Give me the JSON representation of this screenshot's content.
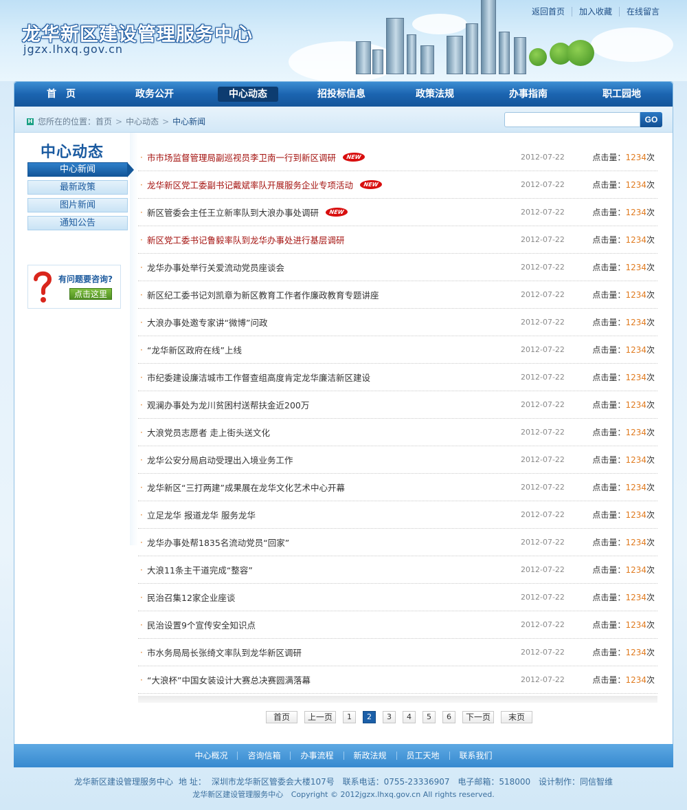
{
  "header": {
    "site_title": "龙华新区建设管理服务中心",
    "site_domain": "jgzx.lhxq.gov.cn",
    "top_links": [
      "返回首页",
      "加入收藏",
      "在线留言"
    ]
  },
  "nav": {
    "items": [
      "首　页",
      "政务公开",
      "中心动态",
      "招投标信息",
      "政策法规",
      "办事指南",
      "职工园地"
    ],
    "active_index": 2
  },
  "breadcrumb": {
    "prefix": "您所在的位置：",
    "items": [
      "首页",
      "中心动态",
      "中心新闻"
    ]
  },
  "search": {
    "placeholder": "",
    "button_label": "GO"
  },
  "sidebar": {
    "title": "中心动态",
    "items": [
      "中心新闻",
      "最新政策",
      "图片新闻",
      "通知公告"
    ],
    "active_index": 0,
    "consult_text": "有问题要咨询?",
    "consult_button": "点击这里"
  },
  "news": {
    "hits_label": "点击量：",
    "hits_unit": "次",
    "items": [
      {
        "title": "市市场监督管理局副巡视员李卫南一行到新区调研",
        "date": "2012-07-22",
        "hits": "1234",
        "hot": true,
        "new": true
      },
      {
        "title": "龙华新区党工委副书记戴斌率队开展服务企业专项活动",
        "date": "2012-07-22",
        "hits": "1234",
        "hot": true,
        "new": true
      },
      {
        "title": "新区管委会主任王立新率队到大浪办事处调研",
        "date": "2012-07-22",
        "hits": "1234",
        "hot": false,
        "new": true
      },
      {
        "title": "新区党工委书记鲁毅率队到龙华办事处进行基层调研",
        "date": "2012-07-22",
        "hits": "1234",
        "hot": true,
        "new": false
      },
      {
        "title": "龙华办事处举行关爱流动党员座谈会",
        "date": "2012-07-22",
        "hits": "1234",
        "hot": false,
        "new": false
      },
      {
        "title": "新区纪工委书记刘凯章为新区教育工作者作廉政教育专题讲座",
        "date": "2012-07-22",
        "hits": "1234",
        "hot": false,
        "new": false
      },
      {
        "title": "大浪办事处邀专家讲“微博”问政",
        "date": "2012-07-22",
        "hits": "1234",
        "hot": false,
        "new": false
      },
      {
        "title": "“龙华新区政府在线”上线",
        "date": "2012-07-22",
        "hits": "1234",
        "hot": false,
        "new": false
      },
      {
        "title": "市纪委建设廉洁城市工作督查组高度肯定龙华廉洁新区建设",
        "date": "2012-07-22",
        "hits": "1234",
        "hot": false,
        "new": false
      },
      {
        "title": "观澜办事处为龙川贫困村送帮扶金近200万",
        "date": "2012-07-22",
        "hits": "1234",
        "hot": false,
        "new": false
      },
      {
        "title": "大浪党员志愿者 走上街头送文化",
        "date": "2012-07-22",
        "hits": "1234",
        "hot": false,
        "new": false
      },
      {
        "title": "龙华公安分局启动受理出入境业务工作",
        "date": "2012-07-22",
        "hits": "1234",
        "hot": false,
        "new": false
      },
      {
        "title": "龙华新区“三打两建”成果展在龙华文化艺术中心开幕",
        "date": "2012-07-22",
        "hits": "1234",
        "hot": false,
        "new": false
      },
      {
        "title": "立足龙华 报道龙华 服务龙华",
        "date": "2012-07-22",
        "hits": "1234",
        "hot": false,
        "new": false
      },
      {
        "title": "龙华办事处帮1835名流动党员“回家”",
        "date": "2012-07-22",
        "hits": "1234",
        "hot": false,
        "new": false
      },
      {
        "title": "大浪11条主干道完成“整容”",
        "date": "2012-07-22",
        "hits": "1234",
        "hot": false,
        "new": false
      },
      {
        "title": "民治召集12家企业座谈",
        "date": "2012-07-22",
        "hits": "1234",
        "hot": false,
        "new": false
      },
      {
        "title": "民治设置9个宣传安全知识点",
        "date": "2012-07-22",
        "hits": "1234",
        "hot": false,
        "new": false
      },
      {
        "title": "市水务局局长张绮文率队到龙华新区调研",
        "date": "2012-07-22",
        "hits": "1234",
        "hot": false,
        "new": false
      },
      {
        "title": "“大浪杯”中国女装设计大赛总决赛圆满落幕",
        "date": "2012-07-22",
        "hits": "1234",
        "hot": false,
        "new": false
      }
    ],
    "new_badge": "NEW"
  },
  "pager": {
    "first": "首页",
    "prev": "上一页",
    "pages": [
      "1",
      "2",
      "3",
      "4",
      "5",
      "6"
    ],
    "current_index": 1,
    "next": "下一页",
    "last": "末页"
  },
  "footer": {
    "links": [
      "中心概况",
      "咨询信箱",
      "办事流程",
      "新政法规",
      "员工天地",
      "联系我们"
    ],
    "line1": [
      "龙华新区建设管理服务中心",
      "地  址：",
      "深圳市龙华新区管委会大楼107号",
      "联系电话：0755-23336907",
      "电子邮箱：518000",
      "设计制作：同信智维"
    ],
    "line2": [
      "龙华新区建设管理服务中心",
      "Copyright © 2012jgzx.lhxq.gov.cn All rights reserved."
    ]
  },
  "colors": {
    "nav_bg": "#1b64b0",
    "nav_active": "#0d3c70",
    "hot_title": "#a4120f",
    "hits_number": "#e07a1e",
    "footer_bar": "#3689cf"
  }
}
